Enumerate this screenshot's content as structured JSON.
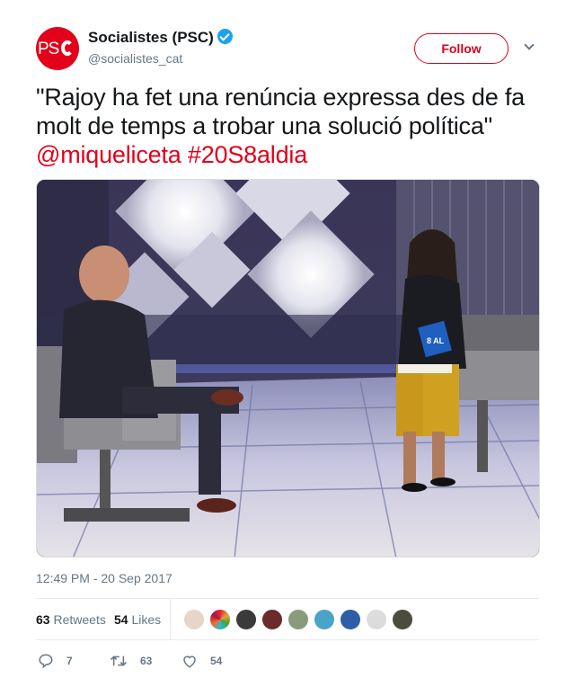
{
  "user": {
    "display_name": "Socialistes (PSC)",
    "handle": "@socialistes_cat",
    "avatar_text": "PS",
    "verified": true,
    "brand_color": "#e2001a"
  },
  "follow_label": "Follow",
  "tweet": {
    "text_line": "\"Rajoy ha fet una renúncia expressa des de fa molt de temps a trobar una solució política\"",
    "mention": "@miqueliceta",
    "hashtag": "#20S8aldia"
  },
  "media": {
    "screen_logo": "8 AL"
  },
  "timestamp": "12:49 PM - 20 Sep 2017",
  "stats": {
    "retweets_count": "63",
    "retweets_label": "Retweets",
    "likes_count": "54",
    "likes_label": "Likes"
  },
  "actions": {
    "replies": "7",
    "retweets": "63",
    "likes": "54"
  },
  "icons": [
    "verified-icon",
    "chevron-down-icon",
    "reply-icon",
    "retweet-icon",
    "heart-icon"
  ]
}
